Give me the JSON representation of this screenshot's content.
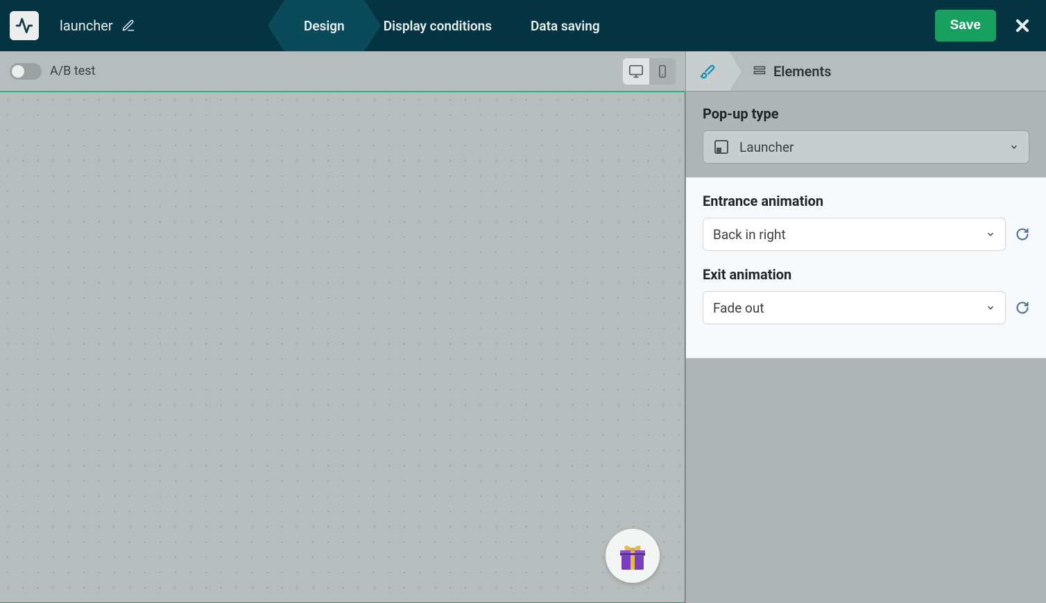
{
  "header": {
    "title": "launcher",
    "tabs": {
      "design": "Design",
      "display": "Display conditions",
      "save": "Data saving"
    },
    "saveBtn": "Save"
  },
  "toolbar": {
    "abTest": "A/B test"
  },
  "panel": {
    "elementsTab": "Elements",
    "popupType": {
      "label": "Pop-up type",
      "value": "Launcher"
    },
    "entrance": {
      "label": "Entrance animation",
      "value": "Back in right"
    },
    "exit": {
      "label": "Exit animation",
      "value": "Fade out"
    }
  }
}
